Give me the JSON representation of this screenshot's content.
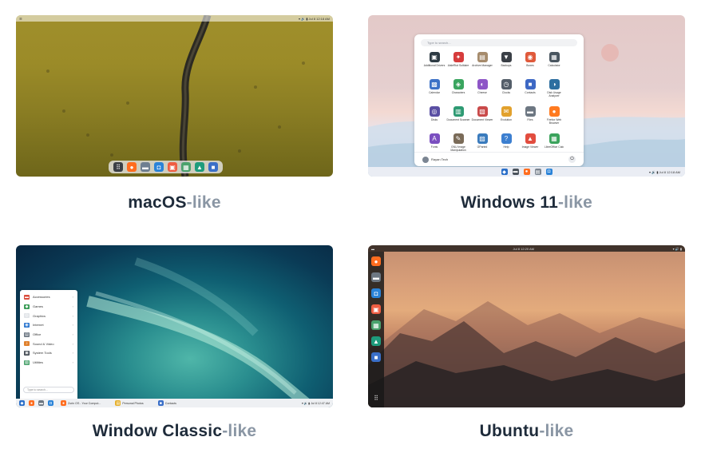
{
  "cards": [
    {
      "id": "mac",
      "caption_main": "macOS",
      "caption_suffix": "-like",
      "topbar": {
        "left": "☰",
        "right": "▾ 🔊 ▮  Jul 8  12:18 AM"
      },
      "dock_icons": [
        {
          "name": "app-grid-icon",
          "glyph": "⠿",
          "color": "#3b3f45"
        },
        {
          "name": "firefox-icon",
          "glyph": "●",
          "color": "#ff6d1f"
        },
        {
          "name": "files-icon",
          "glyph": "▬",
          "color": "#6f7f91"
        },
        {
          "name": "software-icon",
          "glyph": "◘",
          "color": "#2a83d8"
        },
        {
          "name": "document-icon",
          "glyph": "▣",
          "color": "#ef5e43"
        },
        {
          "name": "extensions-icon",
          "glyph": "▦",
          "color": "#4aa26d"
        },
        {
          "name": "photos-icon",
          "glyph": "▲",
          "color": "#1e9c7c"
        },
        {
          "name": "contacts-icon",
          "glyph": "■",
          "color": "#3a6fc8"
        }
      ]
    },
    {
      "id": "win",
      "caption_main": "Windows 11",
      "caption_suffix": "-like",
      "search_placeholder": "Type to search...",
      "apps": [
        {
          "label": "Additional Drivers",
          "color": "#2e3b44",
          "glyph": "▣"
        },
        {
          "label": "AisleRiot Solitaire",
          "color": "#d63c3c",
          "glyph": "✦"
        },
        {
          "label": "Archive Manager",
          "color": "#a68b6c",
          "glyph": "▤"
        },
        {
          "label": "Backups",
          "color": "#3a3f46",
          "glyph": "▼"
        },
        {
          "label": "Boxes",
          "color": "#e05a3b",
          "glyph": "◉"
        },
        {
          "label": "Calculator",
          "color": "#4a5660",
          "glyph": "▦"
        },
        {
          "label": "Calendar",
          "color": "#3d72c7",
          "glyph": "▩"
        },
        {
          "label": "Characters",
          "color": "#3aa55f",
          "glyph": "◈"
        },
        {
          "label": "Cheese",
          "color": "#8e56c7",
          "glyph": "◐"
        },
        {
          "label": "Clocks",
          "color": "#545e69",
          "glyph": "◷"
        },
        {
          "label": "Contacts",
          "color": "#3d68c4",
          "glyph": "■"
        },
        {
          "label": "Disk Usage Analyzer",
          "color": "#2d6fa0",
          "glyph": "◑"
        },
        {
          "label": "Disks",
          "color": "#5a4fa3",
          "glyph": "◎"
        },
        {
          "label": "Document Scanner",
          "color": "#2e9a73",
          "glyph": "▥"
        },
        {
          "label": "Document Viewer",
          "color": "#c94a4a",
          "glyph": "▧"
        },
        {
          "label": "Evolution",
          "color": "#e2a12d",
          "glyph": "✉"
        },
        {
          "label": "Files",
          "color": "#6d7782",
          "glyph": "▬"
        },
        {
          "label": "Firefox Web Browser",
          "color": "#ff7a1f",
          "glyph": "●"
        },
        {
          "label": "Fonts",
          "color": "#7b4fc0",
          "glyph": "A"
        },
        {
          "label": "GNU Image Manipulation",
          "color": "#7a6b58",
          "glyph": "✎"
        },
        {
          "label": "GParted",
          "color": "#3a7bbd",
          "glyph": "▨"
        },
        {
          "label": "Help",
          "color": "#3c7fd0",
          "glyph": "?"
        },
        {
          "label": "Image Viewer",
          "color": "#e24d3f",
          "glyph": "▲"
        },
        {
          "label": "LibreOffice Calc",
          "color": "#3ba35c",
          "glyph": "▦"
        }
      ],
      "user_name": "Rayan Tech",
      "taskbar_icons": [
        {
          "name": "zorin-menu-icon",
          "glyph": "◆",
          "color": "#2a6fc9"
        },
        {
          "name": "files-taskbar-icon",
          "glyph": "▬",
          "color": "#4b535c"
        },
        {
          "name": "firefox-taskbar-icon",
          "glyph": "●",
          "color": "#ff6d1f"
        },
        {
          "name": "folder-taskbar-icon",
          "glyph": "▤",
          "color": "#7b8591"
        },
        {
          "name": "store-taskbar-icon",
          "glyph": "◘",
          "color": "#2a83d8"
        }
      ],
      "tray_text": "▾ 🔊 ▮    Jul 8  12:18 AM"
    },
    {
      "id": "classic",
      "caption_main": "Window Classic",
      "caption_suffix": "-like",
      "menu_items": [
        {
          "label": "Accessories",
          "color": "#d94b3b",
          "glyph": "▬"
        },
        {
          "label": "Games",
          "color": "#3c9d58",
          "glyph": "◆"
        },
        {
          "label": "Graphics",
          "color": "#e1e4e8",
          "glyph": "◎"
        },
        {
          "label": "Internet",
          "color": "#3079d0",
          "glyph": "◉"
        },
        {
          "label": "Office",
          "color": "#6b7682",
          "glyph": "▤"
        },
        {
          "label": "Sound & Video",
          "color": "#e0812d",
          "glyph": "♪"
        },
        {
          "label": "System Tools",
          "color": "#3e464f",
          "glyph": "▣"
        },
        {
          "label": "Utilities",
          "color": "#4aa26d",
          "glyph": "▧"
        }
      ],
      "search_placeholder": "Type to search...",
      "taskbar_windows": [
        {
          "label": "Zorin OS - Your Comput...",
          "color": "#ff6d1f",
          "glyph": "●"
        },
        {
          "label": "Personal Photos",
          "color": "#e6b12e",
          "glyph": "▤"
        },
        {
          "label": "Contacts",
          "color": "#3a6fc8",
          "glyph": "■"
        }
      ],
      "tray_text": "▾ 🔊 ▮   Jul 8  12:47 AM"
    },
    {
      "id": "ubuntu",
      "caption_main": "Ubuntu",
      "caption_suffix": "-like",
      "topbar": {
        "left": "▬",
        "center": "Jul 8  12:20 AM",
        "right": "▾ 🔊 ▮"
      },
      "dock_icons": [
        {
          "name": "firefox-icon",
          "glyph": "●",
          "color": "#ff6d1f"
        },
        {
          "name": "files-icon",
          "glyph": "▬",
          "color": "#6d7782"
        },
        {
          "name": "software-icon",
          "glyph": "◘",
          "color": "#2a83d8"
        },
        {
          "name": "document-icon",
          "glyph": "▣",
          "color": "#ef5e43"
        },
        {
          "name": "extensions-icon",
          "glyph": "▦",
          "color": "#4aa26d"
        },
        {
          "name": "photos-icon",
          "glyph": "▲",
          "color": "#1e9c7c"
        },
        {
          "name": "contacts-icon",
          "glyph": "■",
          "color": "#3a6fc8"
        }
      ],
      "app_grid_glyph": "⠿"
    }
  ]
}
